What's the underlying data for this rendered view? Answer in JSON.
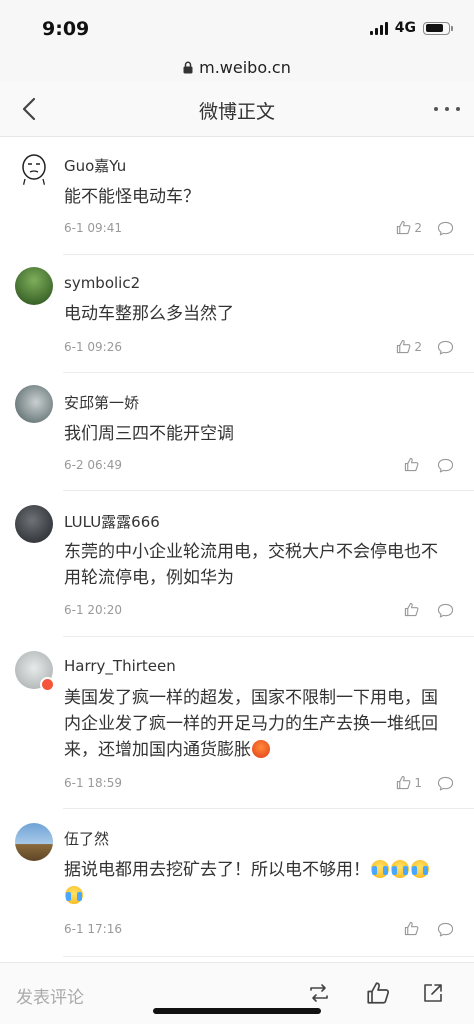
{
  "status_bar": {
    "time": "9:09",
    "network": "4G"
  },
  "browser": {
    "url": "m.weibo.cn"
  },
  "nav": {
    "title": "微博正文"
  },
  "comments": [
    {
      "user": "Guo嘉Yu",
      "text": "能不能怪电动车？",
      "time": "6-1 09:41",
      "likes": "2"
    },
    {
      "user": "symbolic2",
      "text": "电动车整那么多当然了",
      "time": "6-1 09:26",
      "likes": "2"
    },
    {
      "user": "安邱第一娇",
      "text": "我们周三四不能开空调",
      "time": "6-2 06:49",
      "likes": ""
    },
    {
      "user": "LULU露露666",
      "text": "东莞的中小企业轮流用电，交税大户不会停电也不用轮流停电，例如华为",
      "time": "6-1 20:20",
      "likes": ""
    },
    {
      "user": "Harry_Thirteen",
      "text": "美国发了疯一样的超发，国家不限制一下用电，国内企业发了疯一样的开足马力的生产去换一堆纸回来，还增加国内通货膨胀",
      "time": "6-1 18:59",
      "likes": "1"
    },
    {
      "user": "伍了然",
      "text": "据说电都用去挖矿去了！所以电不够用！",
      "time": "6-1 17:16",
      "likes": ""
    }
  ],
  "bottom_bar": {
    "compose_placeholder": "发表评论"
  },
  "colors": {
    "text": "#333333",
    "meta": "#999999",
    "background": "#ffffff",
    "divider": "#ececec"
  },
  "icons": [
    "back-arrow-icon",
    "more-icon",
    "lock-icon",
    "like-icon",
    "reply-icon",
    "repost-icon",
    "share-icon",
    "signal-icon",
    "battery-icon"
  ]
}
